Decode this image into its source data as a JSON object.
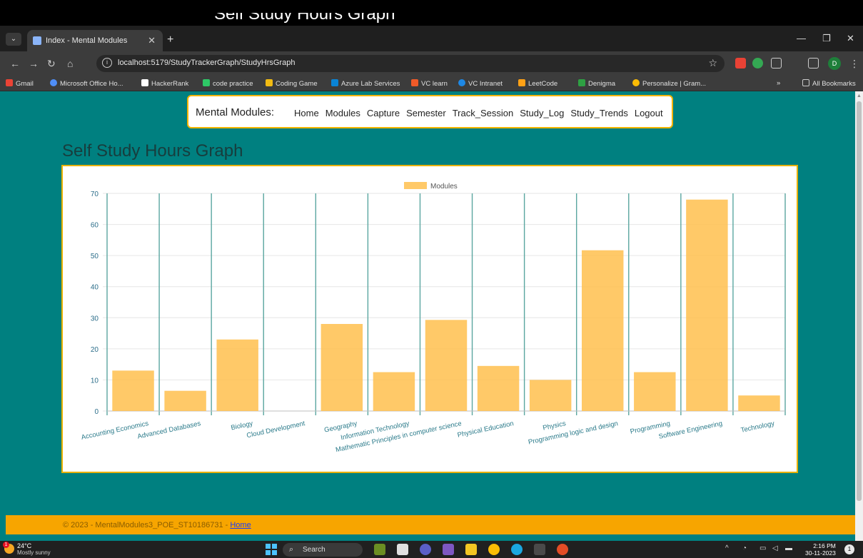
{
  "window": {
    "partial_text": "Self Study Hours Graph"
  },
  "browser": {
    "tab_title": "Index - Mental Modules",
    "url": "localhost:5179/StudyTrackerGraph/StudyHrsGraph",
    "bookmarks": [
      "Gmail",
      "Microsoft Office Ho...",
      "HackerRank",
      "code practice",
      "Coding Game",
      "Azure Lab Services",
      "VC learn",
      "VC Intranet",
      "LeetCode",
      "Denigma",
      "Personalize | Gram..."
    ],
    "all_bookmarks": "All Bookmarks",
    "profile_initial": "D",
    "colors": {
      "tab_bg": "#3c3c3c",
      "toolbar_bg": "#3c3c3c"
    }
  },
  "navbar": {
    "brand": "Mental Modules:",
    "links": [
      "Home",
      "Modules",
      "Capture",
      "Semester",
      "Track_Session",
      "Study_Log",
      "Study_Trends",
      "Logout"
    ]
  },
  "page": {
    "title": "Self Study Hours Graph",
    "background": "#008080"
  },
  "chart_data": {
    "type": "bar",
    "categories": [
      "Accounting Economics",
      "Advanced Databases",
      "Biology",
      "Cloud Development",
      "Geography",
      "Information Technology",
      "Mathematic Principles in computer science",
      "Physical Education",
      "Physics",
      "Programming logic and design",
      "Programming",
      "Software Engineering",
      "Technology"
    ],
    "series": [
      {
        "name": "Modules",
        "values": [
          13,
          6.5,
          23,
          0,
          28,
          12.5,
          29.3,
          14.5,
          10,
          51.7,
          12.5,
          68,
          5
        ]
      }
    ],
    "yticks": [
      "0",
      "10",
      "20",
      "30",
      "40",
      "50",
      "60",
      "70"
    ],
    "ylim": [
      0,
      70
    ],
    "legend": "top-center",
    "grid": true,
    "bar_color": "#ffc04d",
    "title": "",
    "xlabel": "",
    "ylabel": ""
  },
  "footer": {
    "text": "© 2023 - MentalModules3_POE_ST10186731 - ",
    "link": "Home"
  },
  "taskbar": {
    "temperature": "24°C",
    "weather": "Mostly sunny",
    "weather_badge": "1",
    "search_label": "Search",
    "time": "2:16 PM",
    "date": "30-11-2023",
    "notification_count": "1"
  }
}
